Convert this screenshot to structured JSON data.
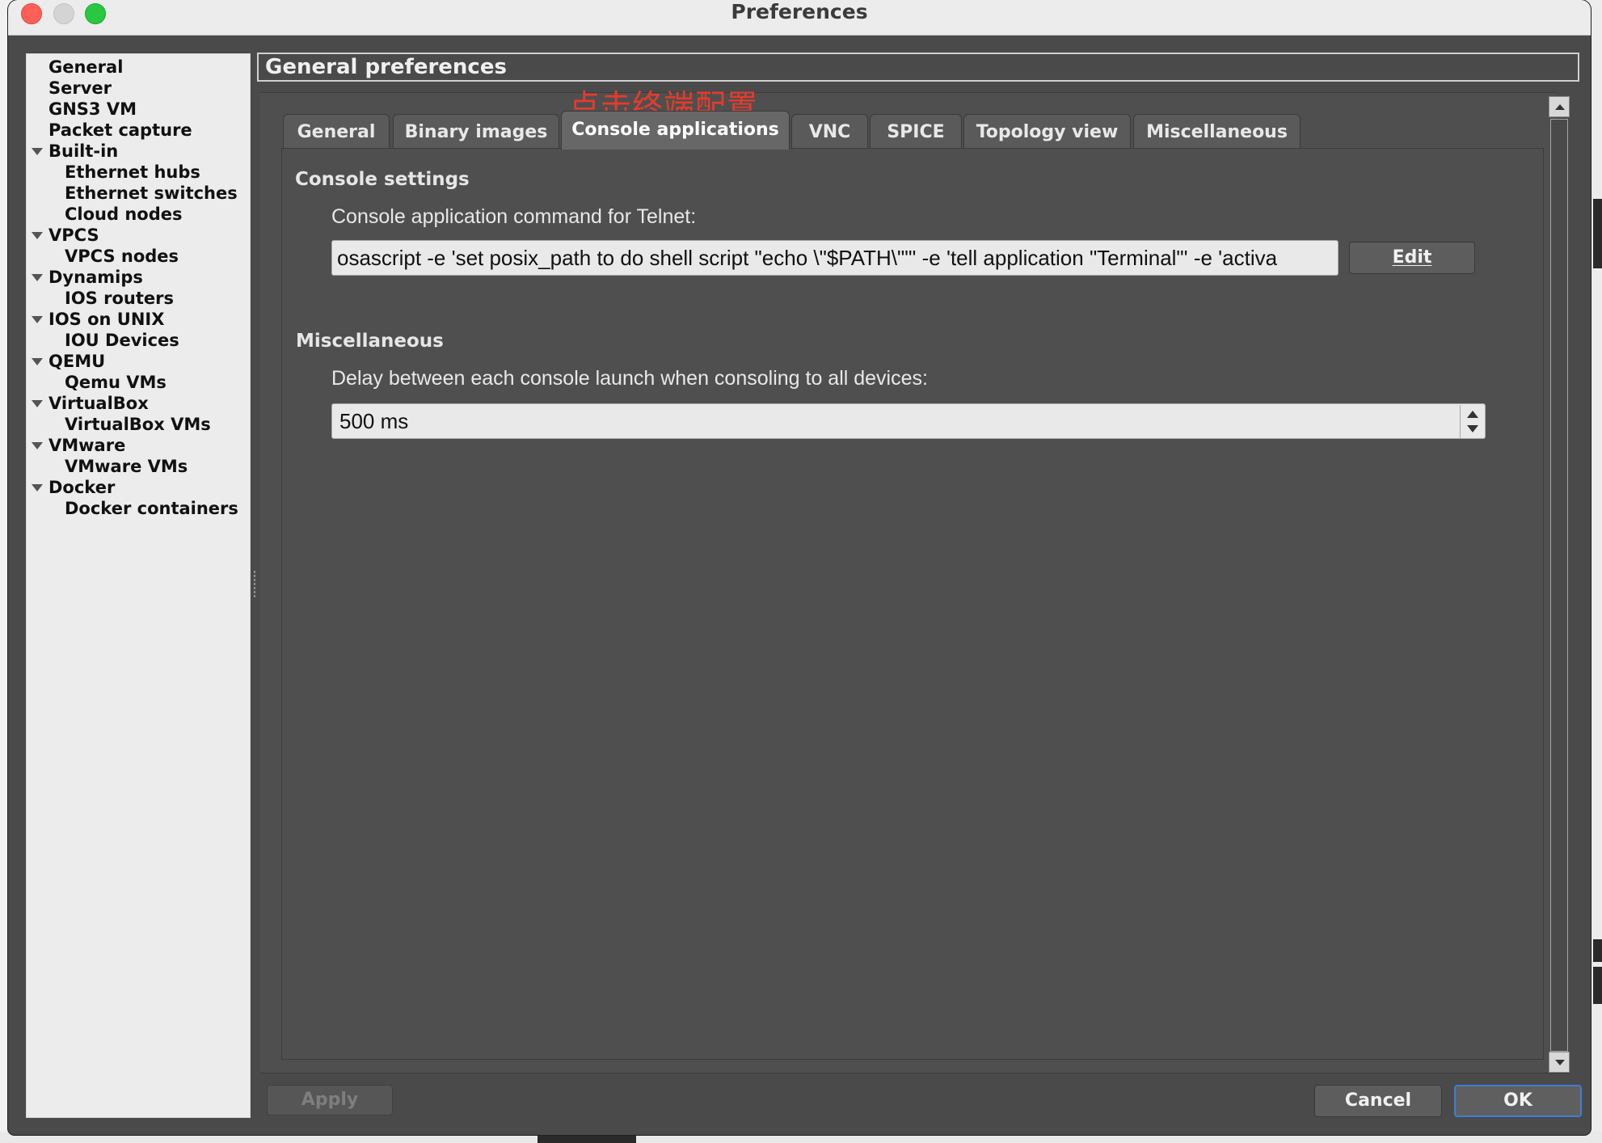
{
  "window": {
    "title": "Preferences"
  },
  "sidebar": {
    "items": [
      {
        "label": "General",
        "level": 0,
        "expandable": false
      },
      {
        "label": "Server",
        "level": 0,
        "expandable": false
      },
      {
        "label": "GNS3 VM",
        "level": 0,
        "expandable": false
      },
      {
        "label": "Packet capture",
        "level": 0,
        "expandable": false
      },
      {
        "label": "Built-in",
        "level": 0,
        "expandable": true
      },
      {
        "label": "Ethernet hubs",
        "level": 1,
        "expandable": false
      },
      {
        "label": "Ethernet switches",
        "level": 1,
        "expandable": false
      },
      {
        "label": "Cloud nodes",
        "level": 1,
        "expandable": false
      },
      {
        "label": "VPCS",
        "level": 0,
        "expandable": true
      },
      {
        "label": "VPCS nodes",
        "level": 1,
        "expandable": false
      },
      {
        "label": "Dynamips",
        "level": 0,
        "expandable": true
      },
      {
        "label": "IOS routers",
        "level": 1,
        "expandable": false
      },
      {
        "label": "IOS on UNIX",
        "level": 0,
        "expandable": true
      },
      {
        "label": "IOU Devices",
        "level": 1,
        "expandable": false
      },
      {
        "label": "QEMU",
        "level": 0,
        "expandable": true
      },
      {
        "label": "Qemu VMs",
        "level": 1,
        "expandable": false
      },
      {
        "label": "VirtualBox",
        "level": 0,
        "expandable": true
      },
      {
        "label": "VirtualBox VMs",
        "level": 1,
        "expandable": false
      },
      {
        "label": "VMware",
        "level": 0,
        "expandable": true
      },
      {
        "label": "VMware VMs",
        "level": 1,
        "expandable": false
      },
      {
        "label": "Docker",
        "level": 0,
        "expandable": true
      },
      {
        "label": "Docker containers",
        "level": 1,
        "expandable": false
      }
    ]
  },
  "main": {
    "title": "General preferences",
    "annotation": "点击终端配置",
    "tabs": [
      {
        "label": "General"
      },
      {
        "label": "Binary images"
      },
      {
        "label": "Console applications",
        "active": true
      },
      {
        "label": "VNC"
      },
      {
        "label": "SPICE"
      },
      {
        "label": "Topology view"
      },
      {
        "label": "Miscellaneous"
      }
    ],
    "console_settings": {
      "group_title": "Console settings",
      "telnet_label": "Console application command for Telnet:",
      "telnet_command": "osascript -e 'set posix_path to do shell script \"echo \\\"$PATH\\\"\"' -e 'tell application \"Terminal\"' -e 'activa",
      "edit_label": "Edit"
    },
    "misc": {
      "group_title": "Miscellaneous",
      "delay_label": "Delay between each console launch when consoling to all devices:",
      "delay_value": "500 ms"
    }
  },
  "footer": {
    "apply_label": "Apply",
    "cancel_label": "Cancel",
    "ok_label": "OK"
  },
  "colors": {
    "accent": "#3f7dd6",
    "annotation": "#e53b2c",
    "close": "#fe5f57",
    "maximize": "#29c840"
  }
}
